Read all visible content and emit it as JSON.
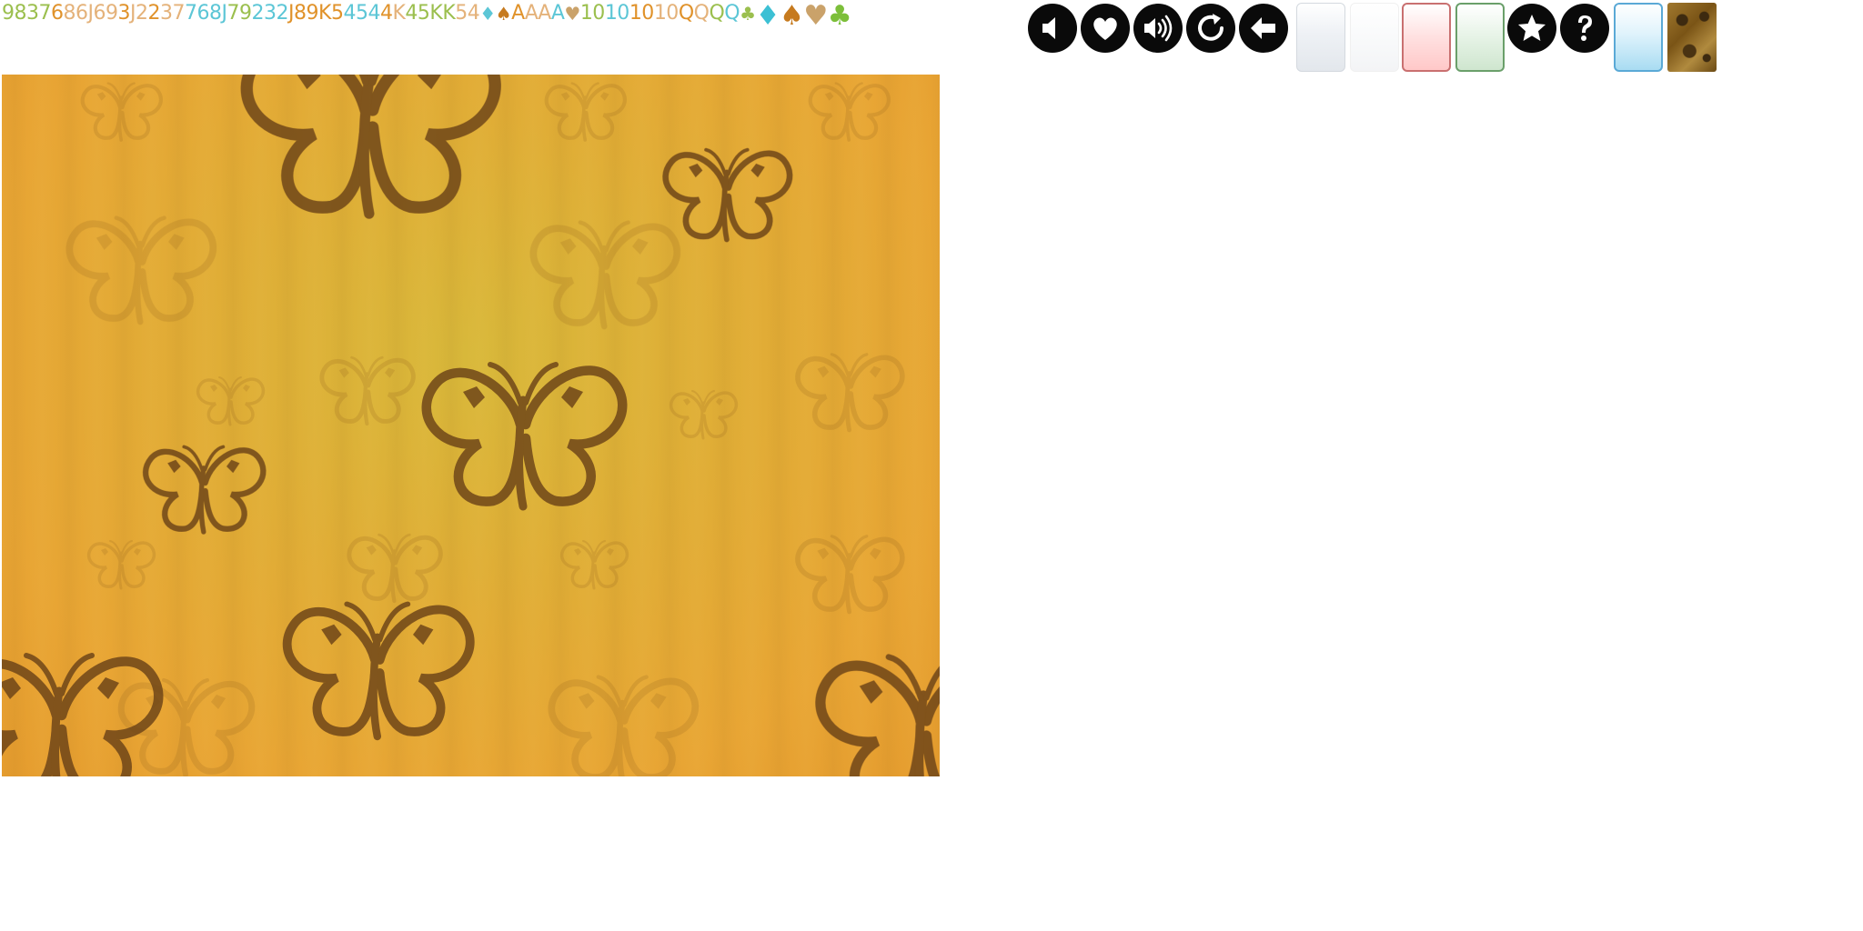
{
  "sprite_strip": {
    "glyphs": [
      {
        "t": "9",
        "c": "#9bbf4e"
      },
      {
        "t": "8",
        "c": "#9bbf4e"
      },
      {
        "t": "3",
        "c": "#9bbf4e"
      },
      {
        "t": "7",
        "c": "#9bbf4e"
      },
      {
        "t": "6",
        "c": "#e0922a"
      },
      {
        "t": "8",
        "c": "#e4b27a"
      },
      {
        "t": "6",
        "c": "#e4b27a"
      },
      {
        "t": "J",
        "c": "#e4b27a"
      },
      {
        "t": "6",
        "c": "#e4b27a"
      },
      {
        "t": "9",
        "c": "#e4b27a"
      },
      {
        "t": "3",
        "c": "#e0922a"
      },
      {
        "t": "J",
        "c": "#e4b27a"
      },
      {
        "t": "2",
        "c": "#e4b27a"
      },
      {
        "t": "2",
        "c": "#e0922a"
      },
      {
        "t": "3",
        "c": "#e4b27a"
      },
      {
        "t": "7",
        "c": "#e4b27a"
      },
      {
        "t": "7",
        "c": "#5cc6d6"
      },
      {
        "t": "6",
        "c": "#5cc6d6"
      },
      {
        "t": "8",
        "c": "#5cc6d6"
      },
      {
        "t": "J",
        "c": "#5cc6d6"
      },
      {
        "t": "7",
        "c": "#9bbf4e"
      },
      {
        "t": "9",
        "c": "#9bbf4e"
      },
      {
        "t": "2",
        "c": "#5cc6d6"
      },
      {
        "t": "3",
        "c": "#5cc6d6"
      },
      {
        "t": "2",
        "c": "#5cc6d6"
      },
      {
        "t": "J",
        "c": "#e0922a"
      },
      {
        "t": "8",
        "c": "#e0922a"
      },
      {
        "t": "9",
        "c": "#e0922a"
      },
      {
        "t": "K",
        "c": "#e0922a"
      },
      {
        "t": "5",
        "c": "#e0922a"
      },
      {
        "t": "4",
        "c": "#5cc6d6"
      },
      {
        "t": "5",
        "c": "#5cc6d6"
      },
      {
        "t": "4",
        "c": "#5cc6d6"
      },
      {
        "t": "4",
        "c": "#e0922a"
      },
      {
        "t": "K",
        "c": "#e4b27a"
      },
      {
        "t": "4",
        "c": "#9bbf4e"
      },
      {
        "t": "5",
        "c": "#9bbf4e"
      },
      {
        "t": "K",
        "c": "#9bbf4e"
      },
      {
        "t": "K",
        "c": "#9bbf4e"
      },
      {
        "t": "5",
        "c": "#e4b27a"
      },
      {
        "t": "4",
        "c": "#e4b27a"
      },
      {
        "t": "♦",
        "c": "#5cc6d6",
        "s": "small"
      },
      {
        "t": "♠",
        "c": "#c67a1e",
        "s": "small"
      },
      {
        "t": "A",
        "c": "#e0922a"
      },
      {
        "t": "A",
        "c": "#e4b27a"
      },
      {
        "t": "A",
        "c": "#e4b27a"
      },
      {
        "t": "A",
        "c": "#5cc6d6"
      },
      {
        "t": "♥",
        "c": "#caa26a",
        "s": "small"
      },
      {
        "t": "10",
        "c": "#9bbf4e"
      },
      {
        "t": "10",
        "c": "#5cc6d6"
      },
      {
        "t": "10",
        "c": "#e0922a"
      },
      {
        "t": "10",
        "c": "#e4b27a"
      },
      {
        "t": "Q",
        "c": "#e0922a"
      },
      {
        "t": "Q",
        "c": "#e4b27a"
      },
      {
        "t": "Q",
        "c": "#9bbf4e"
      },
      {
        "t": "Q",
        "c": "#5cc6d6"
      },
      {
        "t": "♣",
        "c": "#9bbf4e",
        "s": "small"
      },
      {
        "t": "♦",
        "c": "#3cc0d4",
        "s": "big"
      },
      {
        "t": "♠",
        "c": "#c67a1e",
        "s": "big"
      },
      {
        "t": "♥",
        "c": "#caa26a",
        "s": "big"
      },
      {
        "t": "♣",
        "c": "#7cbf3a",
        "s": "big"
      }
    ]
  },
  "icon_buttons": [
    {
      "name": "sound-off-icon-button",
      "icon": "speaker-muted-icon"
    },
    {
      "name": "favorite-icon-button",
      "icon": "heart-icon"
    },
    {
      "name": "sound-on-icon-button",
      "icon": "speaker-on-icon"
    },
    {
      "name": "restart-icon-button",
      "icon": "refresh-icon"
    },
    {
      "name": "back-icon-button",
      "icon": "arrow-left-icon"
    },
    {
      "name": "star-icon-button",
      "icon": "star-icon"
    },
    {
      "name": "help-icon-button",
      "icon": "question-icon"
    }
  ],
  "tiles": [
    {
      "name": "card-tile-gray",
      "color": "#e3e7ec"
    },
    {
      "name": "card-tile-white",
      "color": "#f3f4f6"
    },
    {
      "name": "card-tile-red",
      "color": "#ffc8c8"
    },
    {
      "name": "card-tile-green",
      "color": "#cfe6cf"
    },
    {
      "name": "card-tile-blue",
      "color": "#a9dcf2"
    },
    {
      "name": "card-back-wood",
      "color": "#7a5416"
    }
  ],
  "background": {
    "name": "butterfly-background",
    "base_color": "#e8a534",
    "center_color": "#d8b83a",
    "motif_color": "#6b4218"
  }
}
